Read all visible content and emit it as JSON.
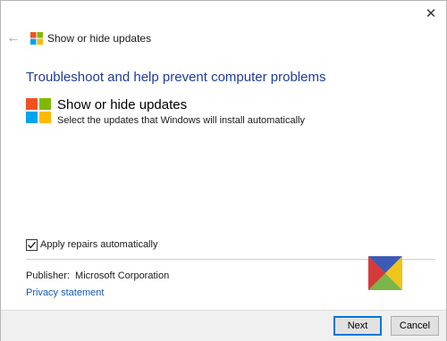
{
  "window": {
    "title": "Show or hide updates",
    "close_glyph": "✕",
    "back_glyph": "←"
  },
  "main": {
    "heading": "Troubleshoot and help prevent computer problems",
    "item": {
      "title": "Show or hide updates",
      "description": "Select the updates that Windows will install automatically",
      "icon": "windows-logo-icon"
    },
    "apply_repairs": {
      "label": "Apply repairs automatically",
      "checked": true
    },
    "publisher_label": "Publisher:",
    "publisher_value": "Microsoft Corporation",
    "privacy_link": "Privacy statement"
  },
  "footer": {
    "next_label": "Next",
    "cancel_label": "Cancel"
  },
  "colors": {
    "heading": "#1e3c9a",
    "link": "#1558b5",
    "win_red": "#f25022",
    "win_green": "#7fba00",
    "win_blue": "#00a4ef",
    "win_yellow": "#ffb900"
  }
}
